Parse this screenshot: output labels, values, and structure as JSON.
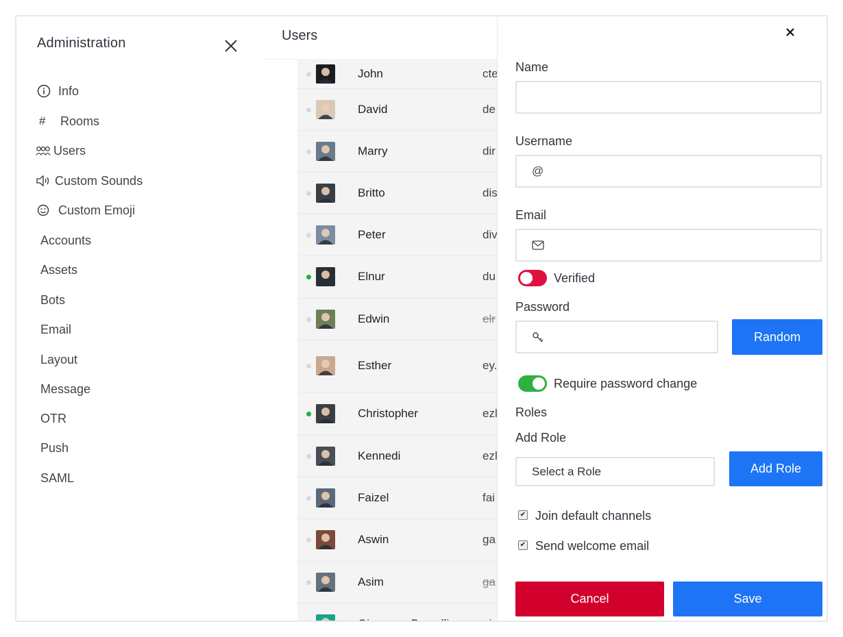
{
  "sidebar": {
    "title": "Administration",
    "close_icon": "close-icon",
    "items": [
      {
        "label": "Info",
        "icon": "info-icon"
      },
      {
        "label": "Rooms",
        "icon": "hash-icon"
      },
      {
        "label": "Users",
        "icon": "users-icon"
      },
      {
        "label": "Custom Sounds",
        "icon": "speaker-icon"
      },
      {
        "label": "Custom Emoji",
        "icon": "emoji-icon"
      },
      {
        "label": "Accounts"
      },
      {
        "label": "Assets"
      },
      {
        "label": "Bots"
      },
      {
        "label": "Email"
      },
      {
        "label": "Layout"
      },
      {
        "label": "Message"
      },
      {
        "label": "OTR"
      },
      {
        "label": "Push"
      },
      {
        "label": "SAML"
      }
    ]
  },
  "users": {
    "title": "Users",
    "rows": [
      {
        "name": "John",
        "cut": "cte",
        "status": "offline"
      },
      {
        "name": "David",
        "cut": "de",
        "status": "offline"
      },
      {
        "name": "Marry",
        "cut": "dir",
        "status": "offline"
      },
      {
        "name": "Britto",
        "cut": "dis",
        "status": "offline"
      },
      {
        "name": "Peter",
        "cut": "div",
        "status": "offline"
      },
      {
        "name": "Elnur",
        "cut": "du",
        "status": "online"
      },
      {
        "name": "Edwin",
        "cut": "elr",
        "status": "offline"
      },
      {
        "name": "Esther",
        "cut": "ey.",
        "status": "offline"
      },
      {
        "name": "Christopher",
        "cut": "ezl",
        "status": "online"
      },
      {
        "name": "Kennedi",
        "cut": "ezl",
        "status": "offline"
      },
      {
        "name": "Faizel",
        "cut": "fai",
        "status": "offline"
      },
      {
        "name": "Aswin",
        "cut": "ga",
        "status": "offline"
      },
      {
        "name": "Asim",
        "cut": "ga",
        "status": "offline"
      },
      {
        "name": "Giuseppe Porcelli",
        "cut": "gi",
        "status": "offline"
      }
    ]
  },
  "form": {
    "name_label": "Name",
    "name_value": "",
    "username_label": "Username",
    "username_prefix": "@",
    "email_label": "Email",
    "verified_label": "Verified",
    "password_label": "Password",
    "random_label": "Random",
    "require_password_label": "Require password change",
    "roles_label": "Roles",
    "add_role_label": "Add Role",
    "role_select_placeholder": "Select a Role",
    "add_role_button": "Add Role",
    "join_default_label": "Join default channels",
    "send_welcome_label": "Send welcome email",
    "cancel_label": "Cancel",
    "save_label": "Save"
  },
  "state": {
    "verified": false,
    "require_password_change": true,
    "join_default_channels": true,
    "send_welcome_email": true
  },
  "colors": {
    "primary_blue": "#1d74f5",
    "danger_red": "#d2002d",
    "toggle_off": "#e0113e",
    "toggle_on": "#2fb043",
    "online": "#22b23a",
    "offline": "#d7d9dc"
  }
}
